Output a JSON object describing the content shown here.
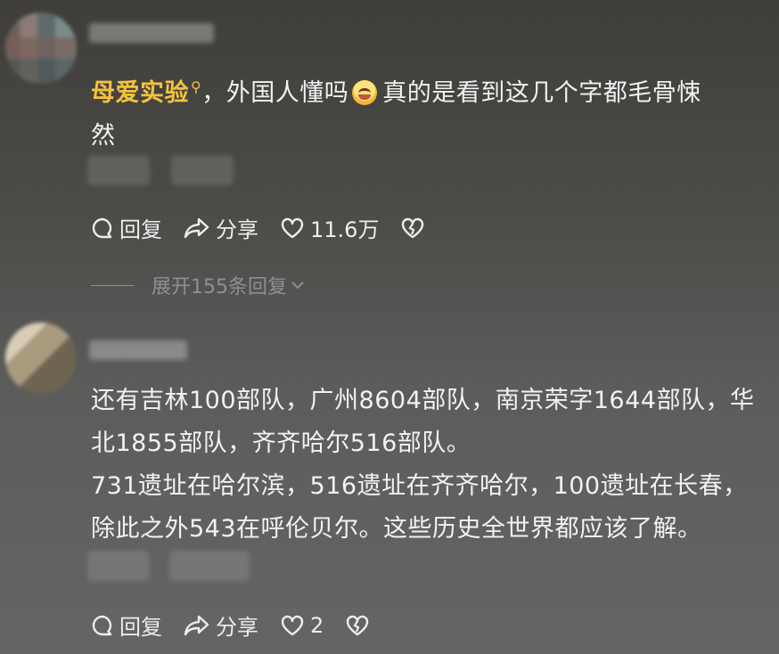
{
  "comments": [
    {
      "mention": "母爱实验",
      "line1_rest": "，外国人懂吗",
      "line1_after_emoji": "真的是看到这几个字都毛骨悚",
      "line2": "然",
      "actions": {
        "reply": "回复",
        "share": "分享",
        "likes": "11.6万"
      },
      "expand_replies": "展开155条回复"
    },
    {
      "lines": [
        "还有吉林100部队，广州8604部队，南京荣字1644部队，华",
        "北1855部队，齐齐哈尔516部队。",
        "731遗址在哈尔滨，516遗址在齐齐哈尔，100遗址在长春，",
        "除此之外543在呼伦贝尔。这些历史全世界都应该了解。"
      ],
      "actions": {
        "reply": "回复",
        "share": "分享",
        "likes": "2"
      }
    }
  ],
  "icons": [
    "comment-bubble-icon",
    "share-arrow-icon",
    "heart-icon",
    "broken-heart-icon",
    "chevron-down-icon",
    "emoji-grin-sweat-icon"
  ],
  "colors": {
    "mention": "#f5c33b",
    "text": "#f2f2f2",
    "muted": "#8f8f8e"
  }
}
